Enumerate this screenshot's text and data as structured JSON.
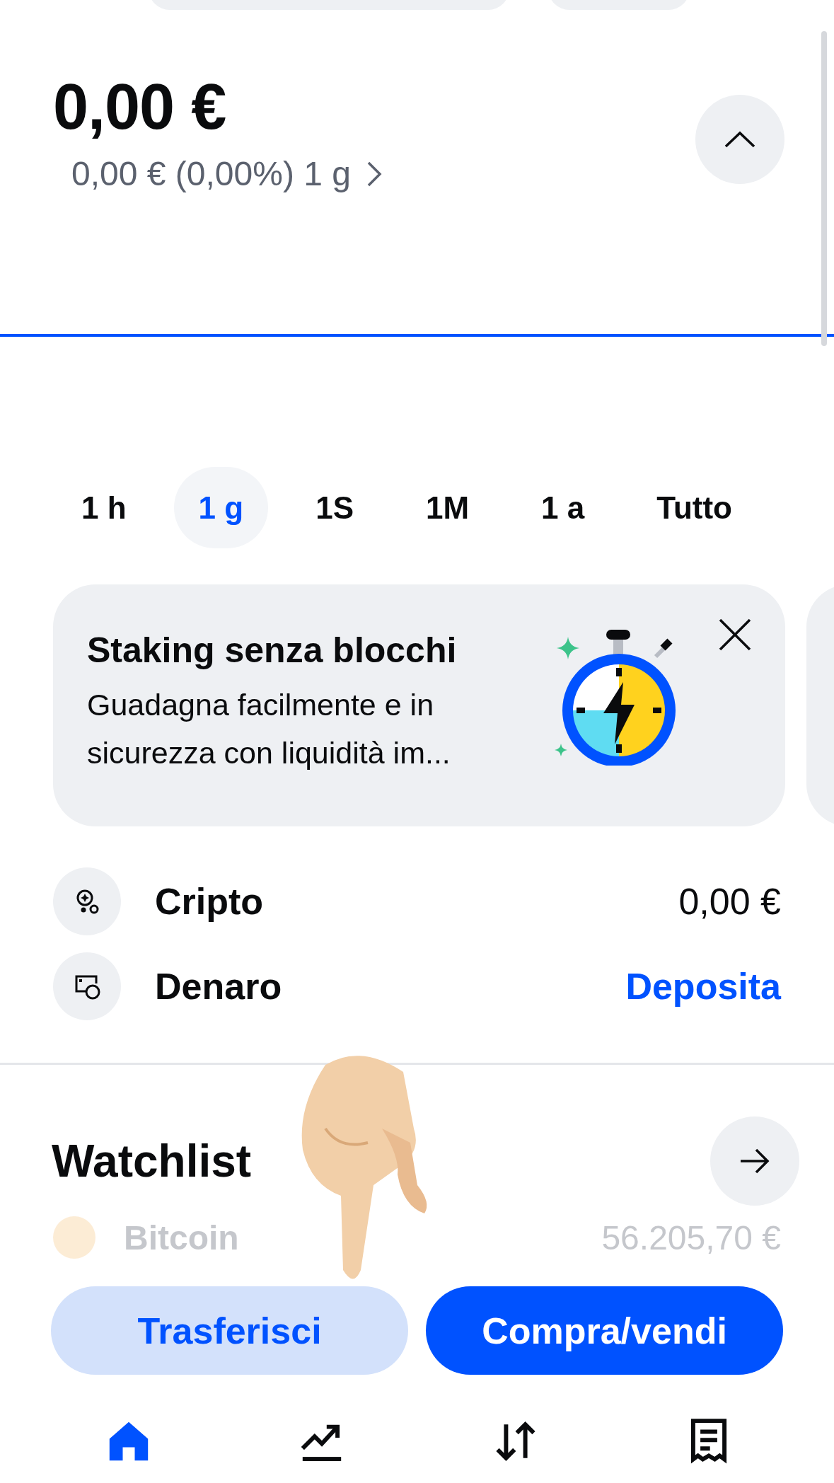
{
  "balance": {
    "amount": "0,00 €",
    "change": "0,00 € (0,00%) 1 g"
  },
  "time_ranges": [
    {
      "label": "1 h",
      "selected": false
    },
    {
      "label": "1 g",
      "selected": true
    },
    {
      "label": "1S",
      "selected": false
    },
    {
      "label": "1M",
      "selected": false
    },
    {
      "label": "1 a",
      "selected": false
    },
    {
      "label": "Tutto",
      "selected": false
    }
  ],
  "promo": {
    "title": "Staking senza blocchi",
    "body": "Guadagna facilmente e in sicurezza con liquidità im..."
  },
  "accounts": [
    {
      "label": "Cripto",
      "value": "0,00 €",
      "kind": "value"
    },
    {
      "label": "Denaro",
      "value": "Deposita",
      "kind": "link"
    }
  ],
  "watchlist": {
    "title": "Watchlist",
    "items": [
      {
        "name": "Bitcoin",
        "price": "56.205,70 €"
      }
    ]
  },
  "actions": [
    {
      "label": "Trasferisci",
      "kind": "secondary"
    },
    {
      "label": "Compra/vendi",
      "kind": "primary"
    }
  ],
  "nav": [
    {
      "selected": true
    },
    {
      "selected": false
    },
    {
      "selected": false
    },
    {
      "selected": false
    }
  ]
}
